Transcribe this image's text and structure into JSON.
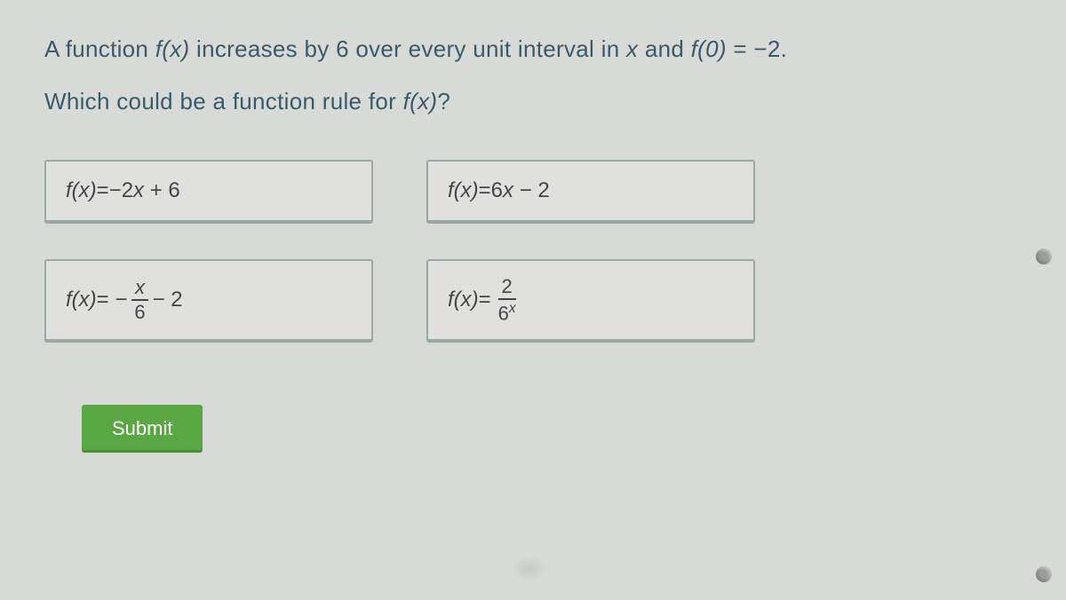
{
  "question": {
    "line1_prefix": "A function ",
    "fx": "f(x)",
    "line1_mid": " increases by 6 over every unit interval in ",
    "xvar": "x",
    "line1_mid2": " and ",
    "f0": "f(0)",
    "line1_suffix": " = −2.",
    "line2_prefix": "Which could be a function rule for ",
    "line2_suffix": "?"
  },
  "options": {
    "a": {
      "lhs": "f(x)",
      "eq": " = ",
      "rhs": "−2x + 6"
    },
    "b": {
      "lhs": "f(x)",
      "eq": " = ",
      "rhs": "6x − 2"
    },
    "c": {
      "lhs": "f(x)",
      "eq": " = −",
      "num": "x",
      "den": "6",
      "tail": " − 2"
    },
    "d": {
      "lhs": "f(x)",
      "eq": " = ",
      "num": "2",
      "den_base": "6",
      "den_exp": "x"
    }
  },
  "submit_label": "Submit"
}
